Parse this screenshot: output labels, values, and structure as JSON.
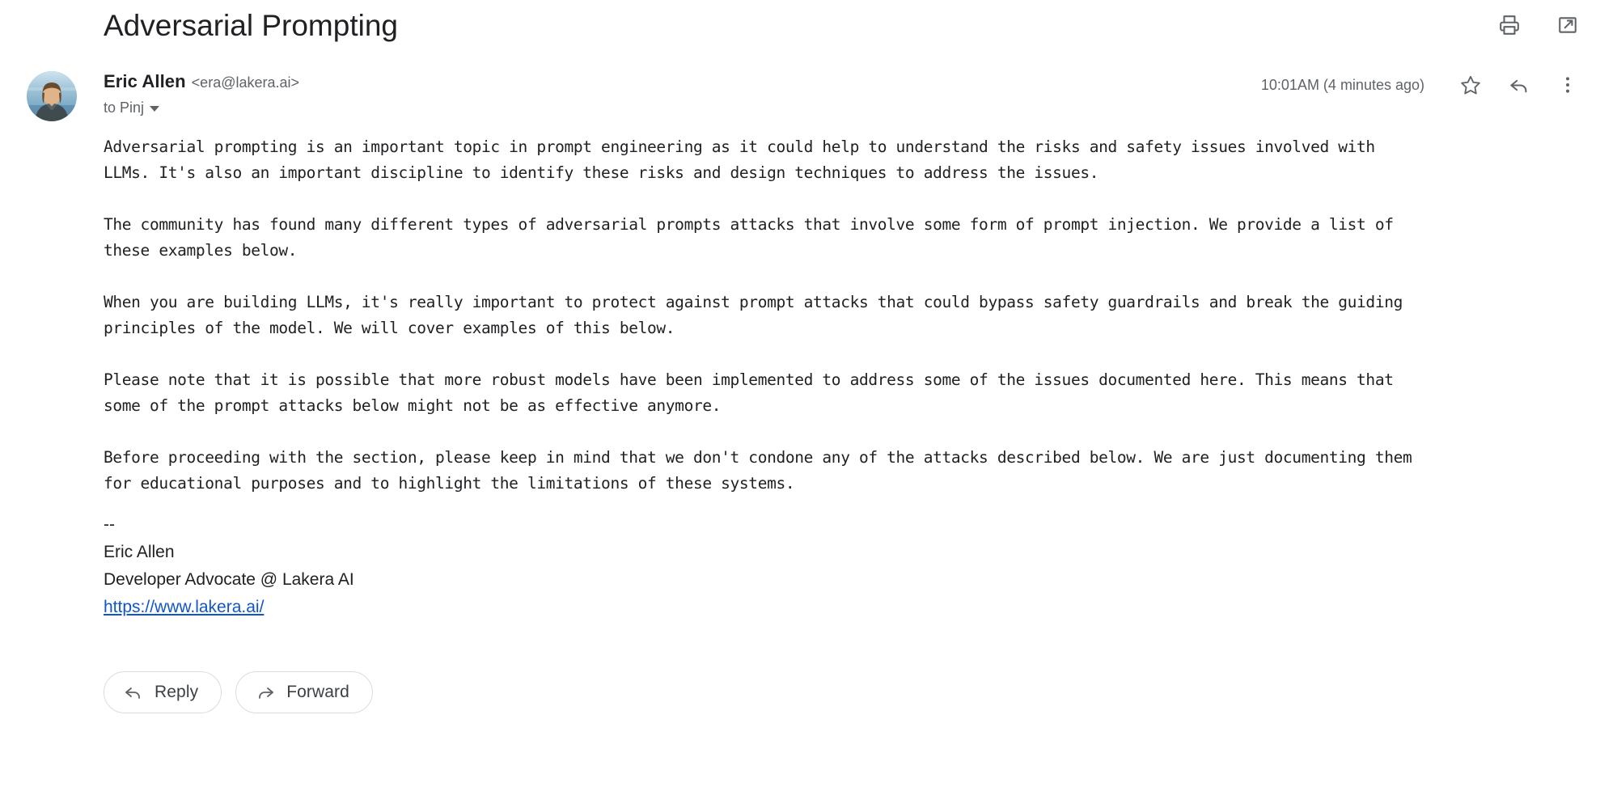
{
  "email": {
    "subject": "Adversarial Prompting",
    "header_actions": [
      {
        "name": "print-icon",
        "label": "Print"
      },
      {
        "name": "open-in-new-icon",
        "label": "Open in new window"
      }
    ],
    "sender": {
      "name": "Eric Allen",
      "email": "<era@lakera.ai>",
      "recipient": "to Pinj",
      "avatar_alt": "Eric Allen avatar"
    },
    "timestamp": "10:01AM (4 minutes ago)",
    "message_actions": [
      {
        "name": "star-icon",
        "label": "Star"
      },
      {
        "name": "reply-icon",
        "label": "Reply"
      },
      {
        "name": "more-options-icon",
        "label": "More"
      }
    ],
    "body_paragraphs": [
      "Adversarial prompting is an important topic in prompt engineering as it could help to understand the risks and safety issues involved with\nLLMs. It's also an important discipline to identify these risks and design techniques to address the issues.",
      "The community has found many different types of adversarial prompts attacks that involve some form of prompt injection. We provide a list of\nthese examples below.",
      "When you are building LLMs, it's really important to protect against prompt attacks that could bypass safety guardrails and break the guiding\nprinciples of the model. We will cover examples of this below.",
      "Please note that it is possible that more robust models have been implemented to address some of the issues documented here. This means that\nsome of the prompt attacks below might not be as effective anymore.",
      "Before proceeding with the section, please keep in mind that we don't condone any of the attacks described below. We are just documenting them\nfor educational purposes and to highlight the limitations of these systems."
    ],
    "signature": {
      "dashes": "--",
      "name": "Eric Allen",
      "title": "Developer Advocate @ Lakera AI",
      "link": "https://www.lakera.ai/"
    },
    "footer_buttons": [
      {
        "name": "reply-button",
        "label": "Reply"
      },
      {
        "name": "forward-button",
        "label": "Forward"
      }
    ],
    "colors": {
      "link": "#1155cc",
      "text_primary": "#202124",
      "text_secondary": "#5f6368",
      "border": "#dadce0",
      "background": "#ffffff"
    }
  }
}
